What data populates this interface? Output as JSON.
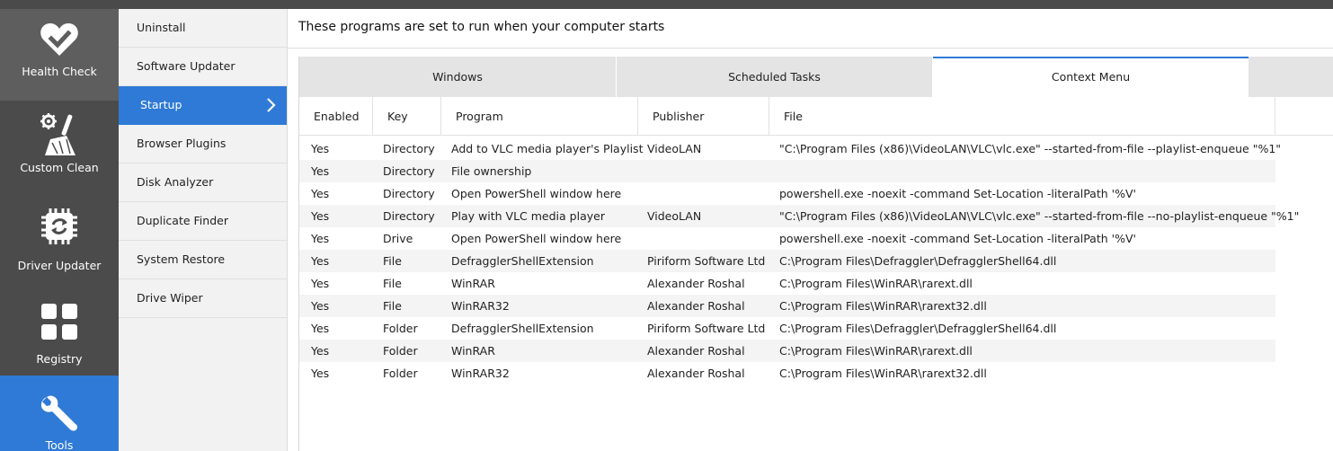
{
  "leftnav": {
    "items": [
      {
        "label": "Health Check",
        "icon": "heart-check-icon"
      },
      {
        "label": "Custom Clean",
        "icon": "gear-broom-icon"
      },
      {
        "label": "Driver Updater",
        "icon": "chip-refresh-icon"
      },
      {
        "label": "Registry",
        "icon": "grid-icon"
      },
      {
        "label": "Tools",
        "icon": "wrench-icon"
      }
    ],
    "active": "Tools"
  },
  "subnav": {
    "items": [
      "Uninstall",
      "Software Updater",
      "Startup",
      "Browser Plugins",
      "Disk Analyzer",
      "Duplicate Finder",
      "System Restore",
      "Drive Wiper"
    ],
    "active": "Startup"
  },
  "main": {
    "heading": "These programs are set to run when your computer starts",
    "tabs": [
      "Windows",
      "Scheduled Tasks",
      "Context Menu"
    ],
    "active_tab": "Context Menu",
    "columns": [
      "Enabled",
      "Key",
      "Program",
      "Publisher",
      "File"
    ],
    "rows": [
      [
        "Yes",
        "Directory",
        "Add to VLC media player's Playlist",
        "VideoLAN",
        "\"C:\\Program Files (x86)\\VideoLAN\\VLC\\vlc.exe\" --started-from-file --playlist-enqueue \"%1\""
      ],
      [
        "Yes",
        "Directory",
        "File ownership",
        "",
        ""
      ],
      [
        "Yes",
        "Directory",
        "Open PowerShell window here",
        "",
        "powershell.exe -noexit -command Set-Location -literalPath '%V'"
      ],
      [
        "Yes",
        "Directory",
        "Play with VLC media player",
        "VideoLAN",
        "\"C:\\Program Files (x86)\\VideoLAN\\VLC\\vlc.exe\" --started-from-file --no-playlist-enqueue \"%1\""
      ],
      [
        "Yes",
        "Drive",
        "Open PowerShell window here",
        "",
        "powershell.exe -noexit -command Set-Location -literalPath '%V'"
      ],
      [
        "Yes",
        "File",
        "DefragglerShellExtension",
        "Piriform Software Ltd",
        "C:\\Program Files\\Defraggler\\DefragglerShell64.dll"
      ],
      [
        "Yes",
        "File",
        "WinRAR",
        "Alexander Roshal",
        "C:\\Program Files\\WinRAR\\rarext.dll"
      ],
      [
        "Yes",
        "File",
        "WinRAR32",
        "Alexander Roshal",
        "C:\\Program Files\\WinRAR\\rarext32.dll"
      ],
      [
        "Yes",
        "Folder",
        "DefragglerShellExtension",
        "Piriform Software Ltd",
        "C:\\Program Files\\Defraggler\\DefragglerShell64.dll"
      ],
      [
        "Yes",
        "Folder",
        "WinRAR",
        "Alexander Roshal",
        "C:\\Program Files\\WinRAR\\rarext.dll"
      ],
      [
        "Yes",
        "Folder",
        "WinRAR32",
        "Alexander Roshal",
        "C:\\Program Files\\WinRAR\\rarext32.dll"
      ]
    ]
  },
  "colors": {
    "accent": "#2f7ad6",
    "nav_dark": "#4b4b4b"
  }
}
